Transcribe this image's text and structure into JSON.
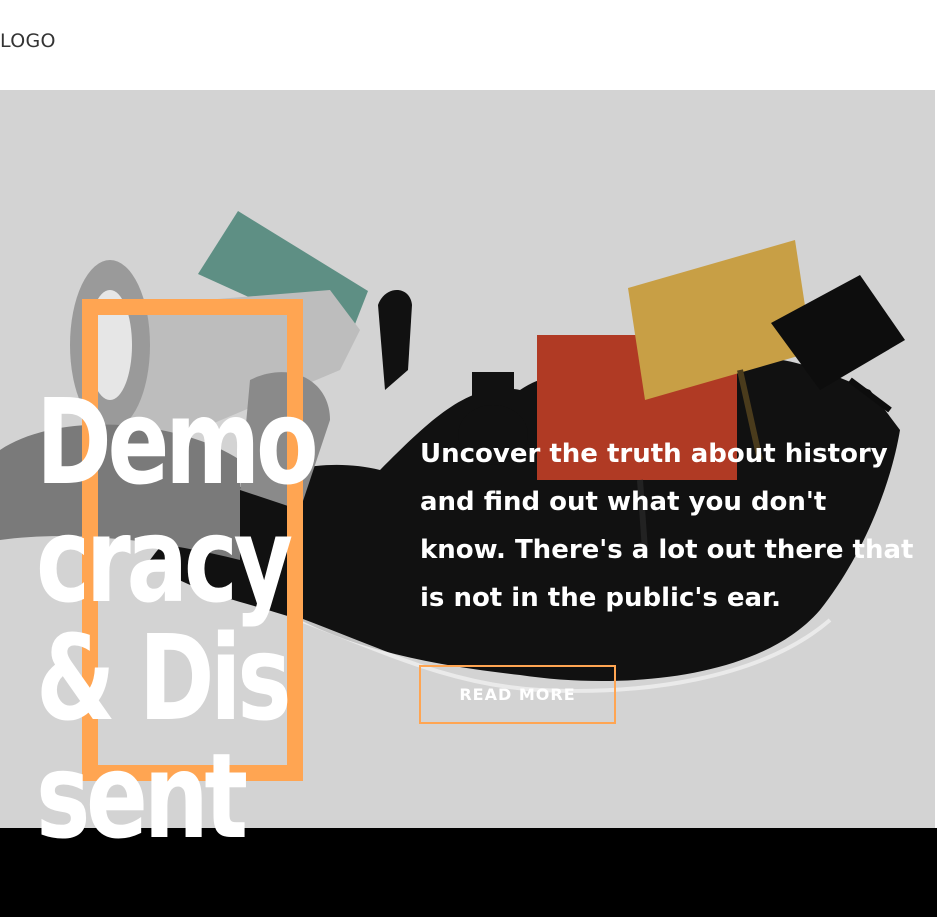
{
  "header": {
    "logo_text": "LOGO"
  },
  "hero": {
    "title": "Democracy & Dissent",
    "description": "Uncover the truth about history and find out what you don't know. There's a lot out there that is not in the public's ear.",
    "cta_label": "READ MORE",
    "colors": {
      "accent": "#ffa552",
      "background": "#d3d3d3",
      "text": "#ffffff"
    }
  }
}
